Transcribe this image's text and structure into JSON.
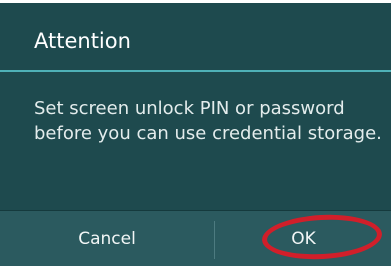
{
  "dialog": {
    "title": "Attention",
    "message": "Set screen unlock PIN or password before you can use credential storage.",
    "buttons": {
      "cancel_label": "Cancel",
      "ok_label": "OK"
    }
  },
  "colors": {
    "dialog_background": "#1e4a4e",
    "title_divider": "#4fb1b7",
    "button_bar": "#2b5a5f",
    "highlight_ring": "#d11f2a"
  }
}
